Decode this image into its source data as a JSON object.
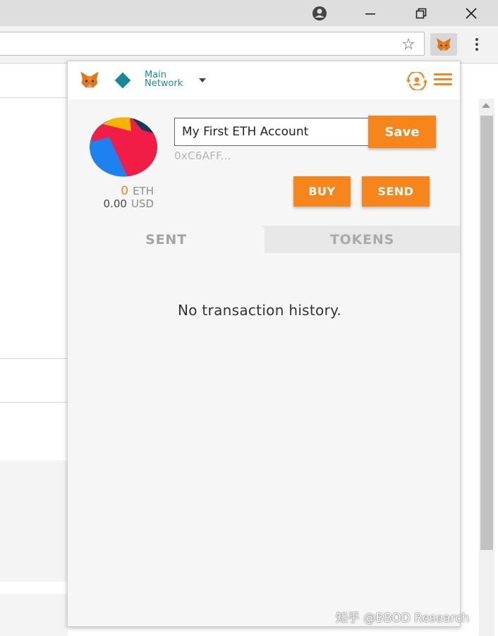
{
  "browser": {
    "window_buttons": {
      "minimize": "–",
      "restore": "❐",
      "close": "✕"
    },
    "url": "",
    "bookmark_icon": "star-icon",
    "extension_icon": "metamask-fox-icon",
    "menu_icon": "more-vertical-icon"
  },
  "popup": {
    "network": {
      "line1": "Main",
      "line2": "Network",
      "color": "#15899a"
    },
    "account": {
      "name": "My First ETH Account",
      "save_label": "Save",
      "address": "0xC6AFF..."
    },
    "balance": {
      "eth_value": "0",
      "eth_unit": "ETH",
      "usd_value": "0.00",
      "usd_unit": "USD"
    },
    "buttons": {
      "buy": "BUY",
      "send": "SEND"
    },
    "tabs": [
      {
        "label": "SENT",
        "active": true
      },
      {
        "label": "TOKENS",
        "active": false
      }
    ],
    "empty_message": "No transaction history.",
    "accent_color": "#f6851b"
  },
  "watermark": "知乎 @BBOD Research"
}
